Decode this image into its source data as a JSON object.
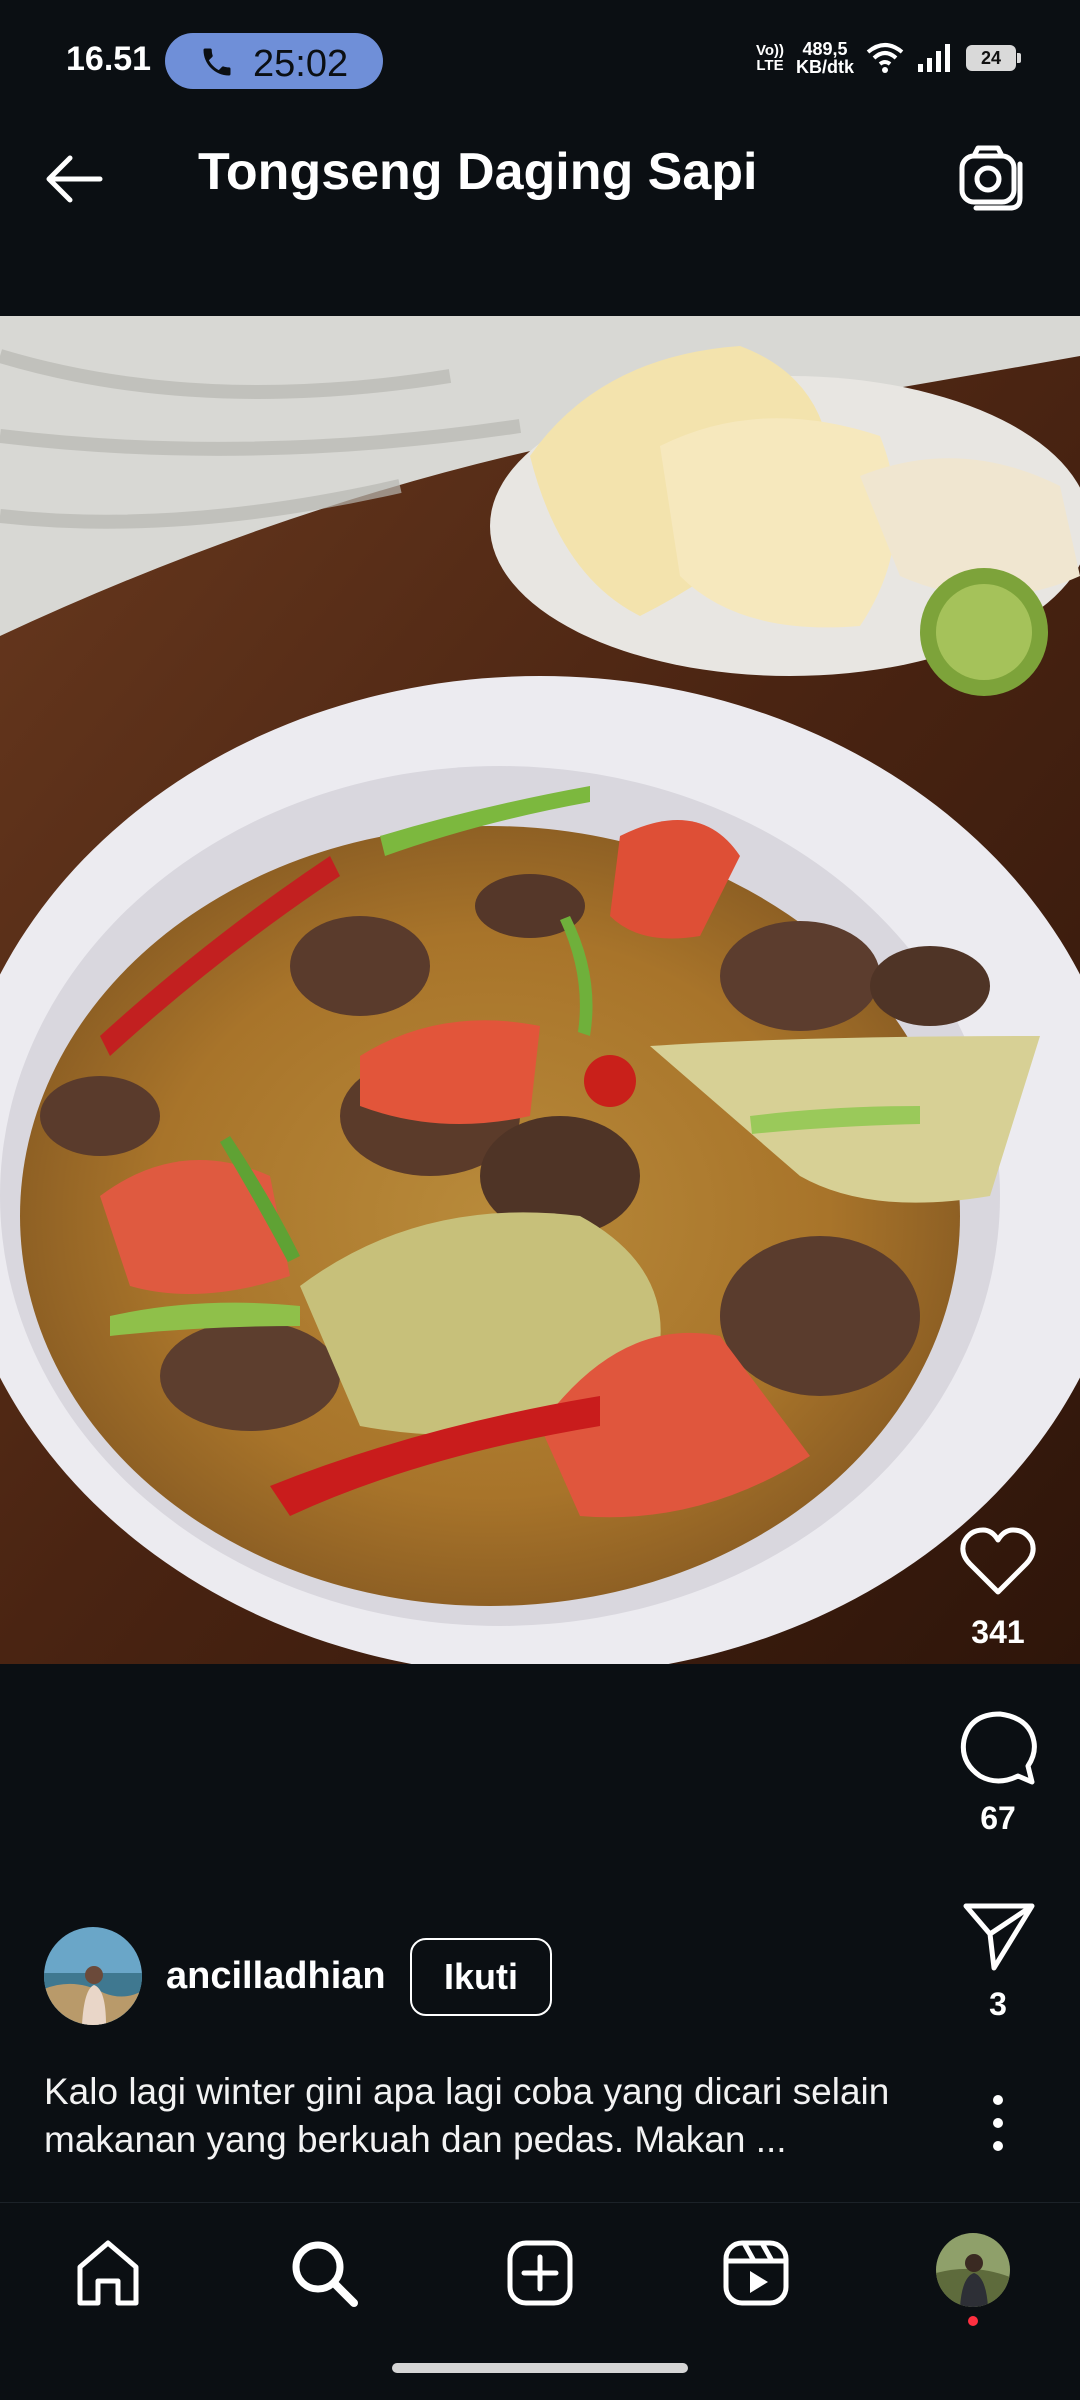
{
  "status_bar": {
    "time": "16.51",
    "call_timer": "25:02",
    "volte_line1": "Vo))",
    "volte_line2": "LTE",
    "speed_line1": "489,5",
    "speed_line2": "KB/dtk",
    "battery": "24"
  },
  "header": {
    "title": "Tongseng Daging Sapi",
    "back_icon": "arrow-left-icon",
    "camera_icon": "camera-icon"
  },
  "post": {
    "image_alt": "Tongseng beef curry bowl with crackers",
    "likes": "341",
    "comments": "67",
    "shares": "3",
    "username": "ancilladhian",
    "follow_label": "Ikuti",
    "caption": "Kalo lagi winter gini apa lagi coba yang dicari selain makanan yang berkuah dan pedas. Makan ..."
  },
  "nav": {
    "items": [
      "home-icon",
      "search-icon",
      "create-icon",
      "reels-icon",
      "profile-avatar"
    ]
  },
  "colors": {
    "background": "#0b0f13",
    "call_pill": "#6f8fd8",
    "notification_dot": "#ff3040"
  }
}
